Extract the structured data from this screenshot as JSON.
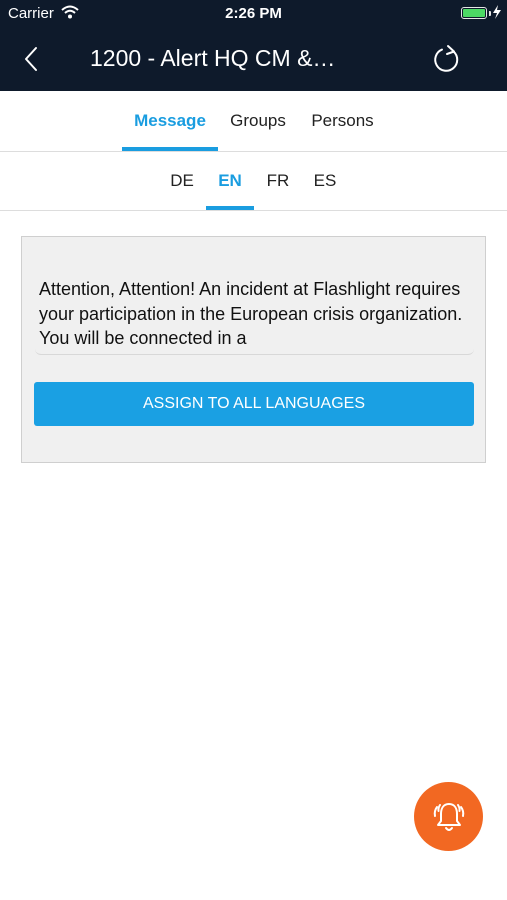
{
  "status_bar": {
    "carrier": "Carrier",
    "time": "2:26 PM",
    "battery_level": 1.0,
    "charging": true
  },
  "header": {
    "title": "1200 - Alert HQ CM &…",
    "back_icon": "chevron-left-icon",
    "refresh_icon": "refresh-icon"
  },
  "tabs": [
    {
      "label": "Message",
      "active": true
    },
    {
      "label": "Groups",
      "active": false
    },
    {
      "label": "Persons",
      "active": false
    }
  ],
  "languages": [
    {
      "label": "DE",
      "active": false
    },
    {
      "label": "EN",
      "active": true
    },
    {
      "label": "FR",
      "active": false
    },
    {
      "label": "ES",
      "active": false
    }
  ],
  "message": {
    "text": "Attention, Attention! An incident at Flashlight requires your participation in the European crisis organization. You will be connected in a"
  },
  "assign_button": {
    "label": "ASSIGN TO ALL LANGUAGES"
  },
  "fab": {
    "icon": "alarm-bell-icon"
  },
  "colors": {
    "header_bg": "#0e1a2b",
    "accent": "#1a9de0",
    "button": "#1aa0e3",
    "fab": "#f26822"
  }
}
